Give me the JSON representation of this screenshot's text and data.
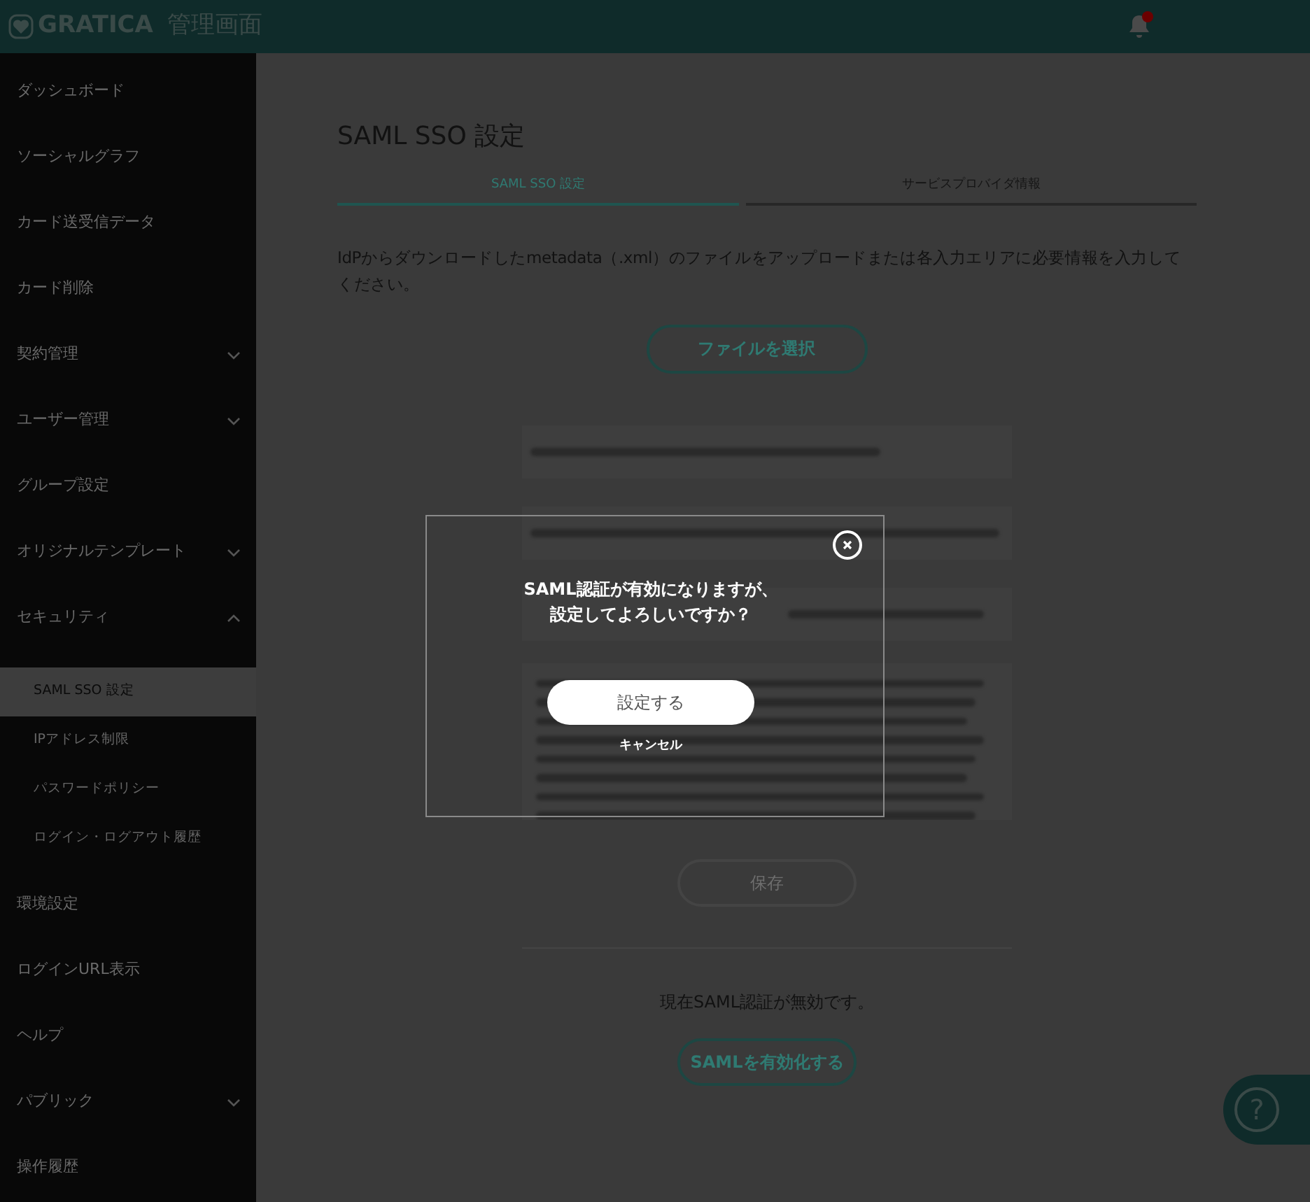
{
  "header": {
    "logo": "GRATICA",
    "subtitle": "管理画面",
    "has_notification": true
  },
  "sidebar": {
    "items": [
      {
        "label": "ダッシュボード"
      },
      {
        "label": "ソーシャルグラフ"
      },
      {
        "label": "カード送受信データ"
      },
      {
        "label": "カード削除"
      },
      {
        "label": "契約管理",
        "expanded": false
      },
      {
        "label": "ユーザー管理",
        "expanded": false
      },
      {
        "label": "グループ設定"
      },
      {
        "label": "オリジナルテンプレート",
        "expanded": false
      },
      {
        "label": "セキュリティ",
        "expanded": true,
        "children": [
          {
            "label": "SAML SSO 設定",
            "selected": true
          },
          {
            "label": "IPアドレス制限",
            "selected": false
          },
          {
            "label": "パスワードポリシー",
            "selected": false
          },
          {
            "label": "ログイン・ログアウト履歴",
            "selected": false
          }
        ]
      },
      {
        "label": "環境設定"
      },
      {
        "label": "ログインURL表示"
      },
      {
        "label": "ヘルプ"
      },
      {
        "label": "パブリック",
        "expanded": false
      },
      {
        "label": "操作履歴"
      }
    ]
  },
  "main": {
    "title": "SAML SSO 設定",
    "tabs": [
      {
        "label": "SAML SSO 設定",
        "selected": true
      },
      {
        "label": "サービスプロバイダ情報",
        "selected": false
      }
    ],
    "description": "IdPからダウンロードしたmetadata（.xml）のファイルをアップロードまたは各入力エリアに必要情報を入力してください。",
    "file_button": "ファイルを選択",
    "fields": [
      {
        "kind": "input"
      },
      {
        "kind": "input"
      },
      {
        "kind": "input"
      },
      {
        "kind": "textarea"
      }
    ],
    "save_button": {
      "label": "保存",
      "disabled": true
    },
    "status_text": "現在SAML認証が無効です。",
    "enable_button": "SAMLを有効化する"
  },
  "dialog": {
    "message": [
      "SAML認証が有効になりますが、",
      "設定してよろしいですか？"
    ],
    "confirm": "設定する",
    "cancel": "キャンセル"
  },
  "help_button": "?"
}
